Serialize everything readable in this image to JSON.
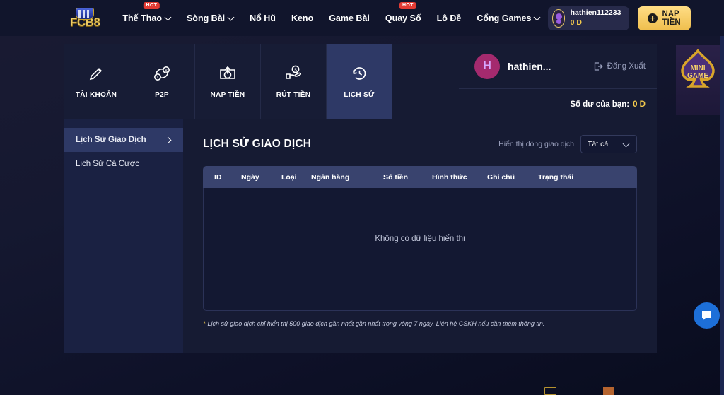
{
  "topnav": {
    "logo_text": "FCB8",
    "links": [
      {
        "label": "Thế Thao",
        "caret": true,
        "badge": "HOT"
      },
      {
        "label": "Sòng Bài",
        "caret": true,
        "badge": ""
      },
      {
        "label": "Nổ Hũ",
        "caret": false,
        "badge": ""
      },
      {
        "label": "Keno",
        "caret": false,
        "badge": ""
      },
      {
        "label": "Game Bài",
        "caret": false,
        "badge": ""
      },
      {
        "label": "Quay Số",
        "caret": false,
        "badge": "HOT"
      },
      {
        "label": "Lô Đề",
        "caret": false,
        "badge": ""
      },
      {
        "label": "Cổng Games",
        "caret": true,
        "badge": ""
      }
    ],
    "user": {
      "name": "hathien112233",
      "balance": "0 D"
    },
    "deposit_label": "NẠP TIỀN"
  },
  "tabs": [
    {
      "label": "TÀI KHOẢN",
      "icon": "pencil-icon",
      "active": false
    },
    {
      "label": "P2P",
      "icon": "p2p-exchange-icon",
      "active": false
    },
    {
      "label": "NẠP TIỀN",
      "icon": "deposit-icon",
      "active": false
    },
    {
      "label": "RÚT TIỀN",
      "icon": "withdraw-icon",
      "active": false
    },
    {
      "label": "LỊCH SỬ",
      "icon": "history-clock-icon",
      "active": true
    }
  ],
  "account": {
    "avatar_initial": "H",
    "display_name": "hathien...",
    "logout_label": "Đăng Xuất",
    "balance_label": "Số dư của bạn:",
    "balance_value": "0 D"
  },
  "sidebar": {
    "items": [
      {
        "label": "Lịch Sử Giao Dịch",
        "active": true
      },
      {
        "label": "Lịch Sử Cá Cược",
        "active": false
      }
    ]
  },
  "content": {
    "title": "LỊCH SỬ GIAO DỊCH",
    "filter_label": "Hiển thị dòng giao dịch",
    "filter_value": "Tất cả",
    "columns": [
      "ID",
      "Ngày",
      "Loại",
      "Ngân hàng",
      "Số tiền",
      "Hình thức",
      "Ghi chú",
      "Trạng thái"
    ],
    "rows": [],
    "empty_message": "Không có dữ liệu hiển thị",
    "note_marker": "*",
    "note_text": "Lịch sử giao dịch chỉ hiển thị 500 giao dịch gần nhất gần nhất trong vòng 7 ngày. Liên hệ CSKH nếu cần thêm thông tin."
  },
  "floaters": {
    "minigame_line1": "MINI",
    "minigame_line2": "GAME",
    "chat_icon": "chat-bubble-icon"
  },
  "colors": {
    "accent_gold": "#f2c94c",
    "active_tab": "#2e3966",
    "table_header": "#39436e",
    "hot_badge": "#e23b34",
    "chat_blue": "#1d6fd8"
  }
}
